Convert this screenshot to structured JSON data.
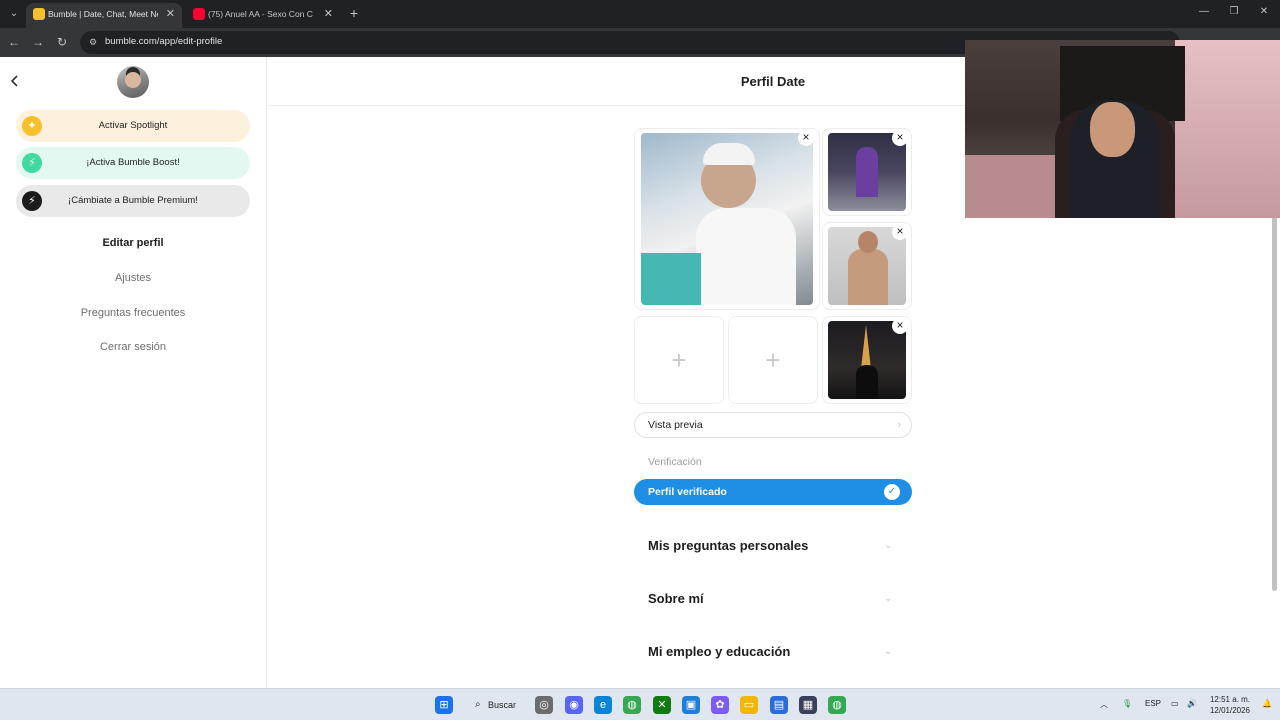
{
  "browser": {
    "tabs": [
      {
        "title": "Bumble | Date, Chat, Meet New",
        "favicon_color": "#f6c02b"
      },
      {
        "title": "(75) Anuel AA - Sexo Con C",
        "favicon_color": "#ff0033"
      }
    ],
    "url": "bumble.com/app/edit-profile"
  },
  "sidebar": {
    "spotlight_label": "Activar Spotlight",
    "boost_label": "¡Activa Bumble Boost!",
    "premium_label": "¡Cámbiate a Bumble Premium!",
    "menu": [
      {
        "label": "Editar perfil"
      },
      {
        "label": "Ajustes"
      },
      {
        "label": "Preguntas frecuentes"
      },
      {
        "label": "Cerrar sesión"
      }
    ]
  },
  "main": {
    "title": "Perfil Date",
    "preview_label": "Vista previa",
    "verification_label": "Verificación",
    "verified_label": "Perfil verificado",
    "sections": [
      {
        "title": "Mis preguntas personales"
      },
      {
        "title": "Sobre mí"
      },
      {
        "title": "Mi empleo y educación"
      }
    ]
  },
  "taskbar": {
    "search_label": "Buscar",
    "lang": "ESP",
    "time": "12:51 a. m.",
    "date": "12/01/2026"
  },
  "colors": {
    "verified_blue": "#1f8fe6",
    "spotlight_yellow": "#f6c02b",
    "boost_green": "#3fd9a2"
  }
}
